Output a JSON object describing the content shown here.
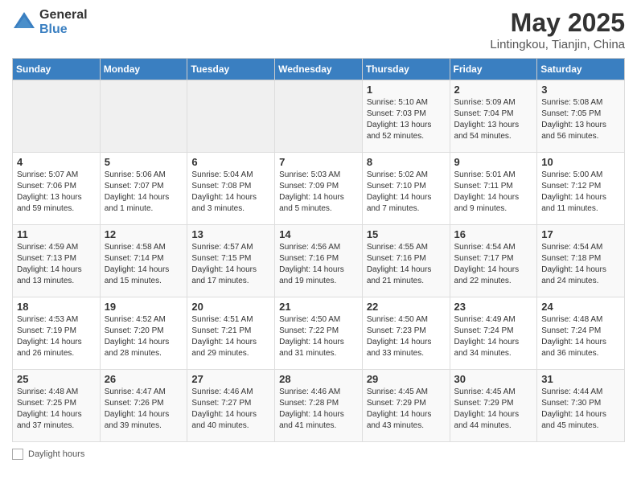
{
  "logo": {
    "general": "General",
    "blue": "Blue"
  },
  "title": "May 2025",
  "subtitle": "Lintingkou, Tianjin, China",
  "weekdays": [
    "Sunday",
    "Monday",
    "Tuesday",
    "Wednesday",
    "Thursday",
    "Friday",
    "Saturday"
  ],
  "footer_label": "Daylight hours",
  "weeks": [
    [
      {
        "day": "",
        "info": ""
      },
      {
        "day": "",
        "info": ""
      },
      {
        "day": "",
        "info": ""
      },
      {
        "day": "",
        "info": ""
      },
      {
        "day": "1",
        "info": "Sunrise: 5:10 AM\nSunset: 7:03 PM\nDaylight: 13 hours\nand 52 minutes."
      },
      {
        "day": "2",
        "info": "Sunrise: 5:09 AM\nSunset: 7:04 PM\nDaylight: 13 hours\nand 54 minutes."
      },
      {
        "day": "3",
        "info": "Sunrise: 5:08 AM\nSunset: 7:05 PM\nDaylight: 13 hours\nand 56 minutes."
      }
    ],
    [
      {
        "day": "4",
        "info": "Sunrise: 5:07 AM\nSunset: 7:06 PM\nDaylight: 13 hours\nand 59 minutes."
      },
      {
        "day": "5",
        "info": "Sunrise: 5:06 AM\nSunset: 7:07 PM\nDaylight: 14 hours\nand 1 minute."
      },
      {
        "day": "6",
        "info": "Sunrise: 5:04 AM\nSunset: 7:08 PM\nDaylight: 14 hours\nand 3 minutes."
      },
      {
        "day": "7",
        "info": "Sunrise: 5:03 AM\nSunset: 7:09 PM\nDaylight: 14 hours\nand 5 minutes."
      },
      {
        "day": "8",
        "info": "Sunrise: 5:02 AM\nSunset: 7:10 PM\nDaylight: 14 hours\nand 7 minutes."
      },
      {
        "day": "9",
        "info": "Sunrise: 5:01 AM\nSunset: 7:11 PM\nDaylight: 14 hours\nand 9 minutes."
      },
      {
        "day": "10",
        "info": "Sunrise: 5:00 AM\nSunset: 7:12 PM\nDaylight: 14 hours\nand 11 minutes."
      }
    ],
    [
      {
        "day": "11",
        "info": "Sunrise: 4:59 AM\nSunset: 7:13 PM\nDaylight: 14 hours\nand 13 minutes."
      },
      {
        "day": "12",
        "info": "Sunrise: 4:58 AM\nSunset: 7:14 PM\nDaylight: 14 hours\nand 15 minutes."
      },
      {
        "day": "13",
        "info": "Sunrise: 4:57 AM\nSunset: 7:15 PM\nDaylight: 14 hours\nand 17 minutes."
      },
      {
        "day": "14",
        "info": "Sunrise: 4:56 AM\nSunset: 7:16 PM\nDaylight: 14 hours\nand 19 minutes."
      },
      {
        "day": "15",
        "info": "Sunrise: 4:55 AM\nSunset: 7:16 PM\nDaylight: 14 hours\nand 21 minutes."
      },
      {
        "day": "16",
        "info": "Sunrise: 4:54 AM\nSunset: 7:17 PM\nDaylight: 14 hours\nand 22 minutes."
      },
      {
        "day": "17",
        "info": "Sunrise: 4:54 AM\nSunset: 7:18 PM\nDaylight: 14 hours\nand 24 minutes."
      }
    ],
    [
      {
        "day": "18",
        "info": "Sunrise: 4:53 AM\nSunset: 7:19 PM\nDaylight: 14 hours\nand 26 minutes."
      },
      {
        "day": "19",
        "info": "Sunrise: 4:52 AM\nSunset: 7:20 PM\nDaylight: 14 hours\nand 28 minutes."
      },
      {
        "day": "20",
        "info": "Sunrise: 4:51 AM\nSunset: 7:21 PM\nDaylight: 14 hours\nand 29 minutes."
      },
      {
        "day": "21",
        "info": "Sunrise: 4:50 AM\nSunset: 7:22 PM\nDaylight: 14 hours\nand 31 minutes."
      },
      {
        "day": "22",
        "info": "Sunrise: 4:50 AM\nSunset: 7:23 PM\nDaylight: 14 hours\nand 33 minutes."
      },
      {
        "day": "23",
        "info": "Sunrise: 4:49 AM\nSunset: 7:24 PM\nDaylight: 14 hours\nand 34 minutes."
      },
      {
        "day": "24",
        "info": "Sunrise: 4:48 AM\nSunset: 7:24 PM\nDaylight: 14 hours\nand 36 minutes."
      }
    ],
    [
      {
        "day": "25",
        "info": "Sunrise: 4:48 AM\nSunset: 7:25 PM\nDaylight: 14 hours\nand 37 minutes."
      },
      {
        "day": "26",
        "info": "Sunrise: 4:47 AM\nSunset: 7:26 PM\nDaylight: 14 hours\nand 39 minutes."
      },
      {
        "day": "27",
        "info": "Sunrise: 4:46 AM\nSunset: 7:27 PM\nDaylight: 14 hours\nand 40 minutes."
      },
      {
        "day": "28",
        "info": "Sunrise: 4:46 AM\nSunset: 7:28 PM\nDaylight: 14 hours\nand 41 minutes."
      },
      {
        "day": "29",
        "info": "Sunrise: 4:45 AM\nSunset: 7:29 PM\nDaylight: 14 hours\nand 43 minutes."
      },
      {
        "day": "30",
        "info": "Sunrise: 4:45 AM\nSunset: 7:29 PM\nDaylight: 14 hours\nand 44 minutes."
      },
      {
        "day": "31",
        "info": "Sunrise: 4:44 AM\nSunset: 7:30 PM\nDaylight: 14 hours\nand 45 minutes."
      }
    ]
  ]
}
